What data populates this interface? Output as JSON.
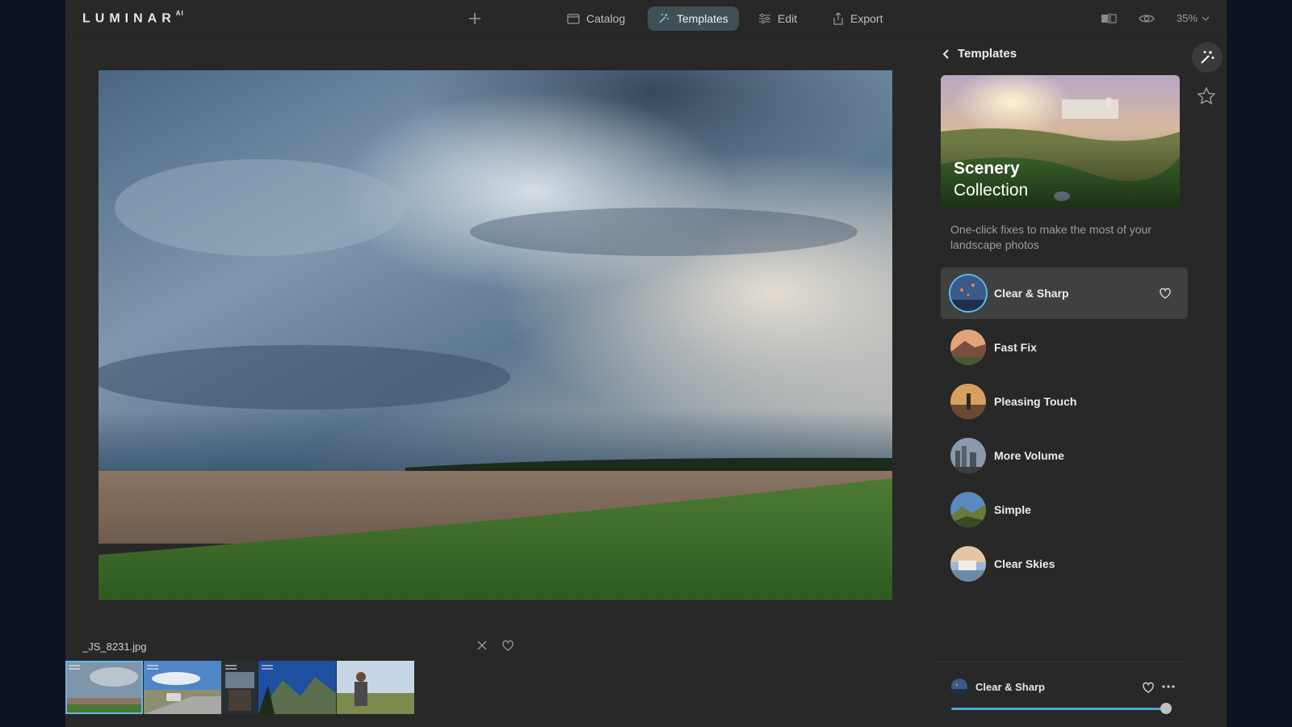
{
  "app": {
    "logo": "LUMINAR",
    "logo_suffix": "AI"
  },
  "nav": {
    "catalog": "Catalog",
    "templates": "Templates",
    "edit": "Edit",
    "export": "Export",
    "zoom": "35%"
  },
  "file": {
    "name": "_JS_8231.jpg"
  },
  "filmstrip": [
    {
      "name": "thumb-storm-clouds",
      "selected": true
    },
    {
      "name": "thumb-car-road",
      "selected": false
    },
    {
      "name": "thumb-train-interior",
      "selected": false
    },
    {
      "name": "thumb-mountains",
      "selected": false
    },
    {
      "name": "thumb-man-field",
      "selected": false
    }
  ],
  "panel": {
    "title": "Templates",
    "collection_title_1": "Scenery",
    "collection_title_2": "Collection",
    "collection_desc": "One-click fixes to make the most of your landscape photos",
    "presets": [
      {
        "label": "Clear & Sharp",
        "active": true
      },
      {
        "label": "Fast Fix"
      },
      {
        "label": "Pleasing Touch"
      },
      {
        "label": "More Volume"
      },
      {
        "label": "Simple"
      },
      {
        "label": "Clear Skies"
      }
    ]
  },
  "applied": {
    "label": "Clear & Sharp",
    "amount": 1.0
  }
}
